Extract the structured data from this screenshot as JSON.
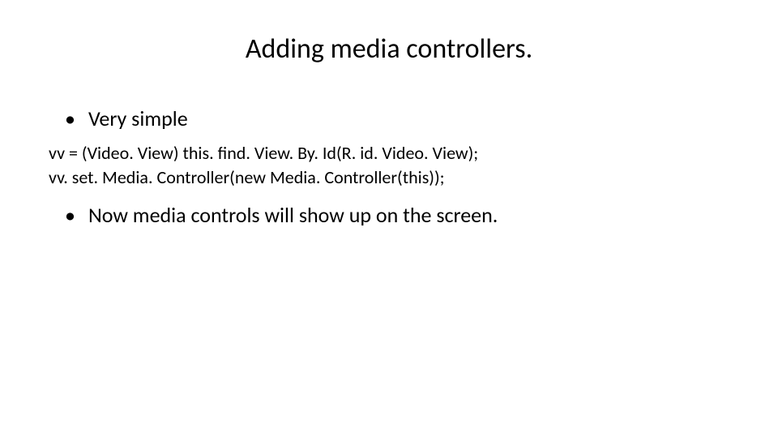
{
  "slide": {
    "title": "Adding media controllers.",
    "bullets": [
      "Very simple"
    ],
    "code": [
      "vv = (Video. View) this. find. View. By. Id(R. id. Video. View);",
      "vv. set. Media. Controller(new Media. Controller(this));"
    ],
    "bullets2": [
      "Now media controls will show up on the screen."
    ]
  }
}
